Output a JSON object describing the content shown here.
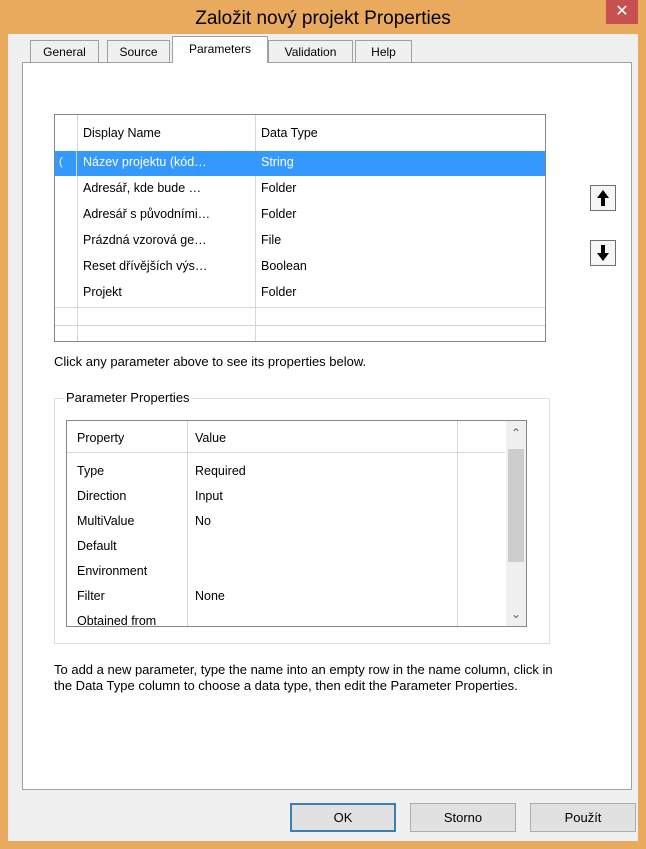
{
  "window": {
    "title": "Založit nový projekt Properties",
    "close_label": "✕",
    "accent_color": "#e9aa5d"
  },
  "tabs": [
    {
      "label": "General",
      "active": false
    },
    {
      "label": "Source",
      "active": false
    },
    {
      "label": "Parameters",
      "active": true
    },
    {
      "label": "Validation",
      "active": false
    },
    {
      "label": "Help",
      "active": false
    }
  ],
  "parameters_grid": {
    "columns": [
      "Display Name",
      "Data Type"
    ],
    "rows": [
      {
        "indicator": "(",
        "name": "Název projektu (kód…",
        "type": "String",
        "selected": true
      },
      {
        "indicator": "",
        "name": "Adresář, kde bude …",
        "type": "Folder",
        "selected": false
      },
      {
        "indicator": "",
        "name": "Adresář s původními…",
        "type": "Folder",
        "selected": false
      },
      {
        "indicator": "",
        "name": "Prázdná vzorová ge…",
        "type": "File",
        "selected": false
      },
      {
        "indicator": "",
        "name": "Reset dřívějších výs…",
        "type": "Boolean",
        "selected": false
      },
      {
        "indicator": "",
        "name": "Projekt",
        "type": "Folder",
        "selected": false
      }
    ]
  },
  "move_buttons": {
    "up_icon": "arrow-up-icon",
    "down_icon": "arrow-down-icon"
  },
  "hint_text": "Click any parameter above to see its properties below.",
  "parameter_properties": {
    "group_title": "Parameter Properties",
    "columns": [
      "Property",
      "Value"
    ],
    "rows": [
      {
        "property": "Type",
        "value": "Required"
      },
      {
        "property": "Direction",
        "value": "Input"
      },
      {
        "property": "MultiValue",
        "value": "No"
      },
      {
        "property": "Default",
        "value": ""
      },
      {
        "property": "Environment",
        "value": ""
      },
      {
        "property": "Filter",
        "value": "None"
      },
      {
        "property": "Obtained from",
        "value": ""
      }
    ]
  },
  "help_text": "To add a new parameter, type the name into an empty row in the name column, click in the Data Type column to choose a data type, then edit the Parameter Properties.",
  "buttons": {
    "ok": "OK",
    "cancel": "Storno",
    "apply": "Použít"
  }
}
